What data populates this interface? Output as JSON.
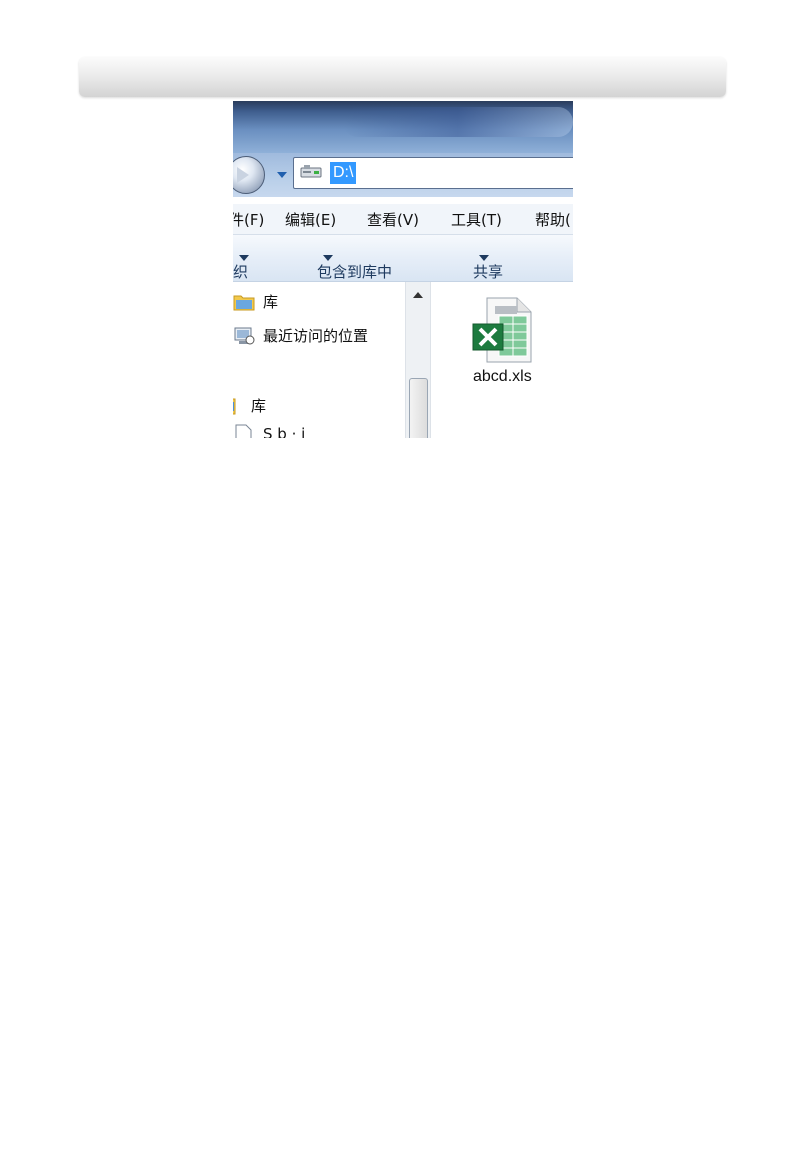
{
  "address_bar": {
    "path": "D:\\"
  },
  "menu": {
    "file": "件(F)",
    "edit": "编辑(E)",
    "view": "查看(V)",
    "tools": "工具(T)",
    "help": "帮助("
  },
  "toolbar": {
    "organize": "织",
    "include_in_library": "包含到库中",
    "share": "共享"
  },
  "nav_pane": {
    "items": [
      {
        "label": "库",
        "icon": "library-folder-icon"
      },
      {
        "label": "最近访问的位置",
        "icon": "recent-places-icon"
      },
      {
        "label": "库",
        "icon": "library-icon"
      },
      {
        "label": "S  b   ·   i",
        "icon": "document-icon"
      }
    ]
  },
  "files": [
    {
      "name": "abcd.xls",
      "icon": "excel-file-icon"
    }
  ],
  "colors": {
    "selection": "#3399ff",
    "excel_green": "#1d7b3f"
  }
}
